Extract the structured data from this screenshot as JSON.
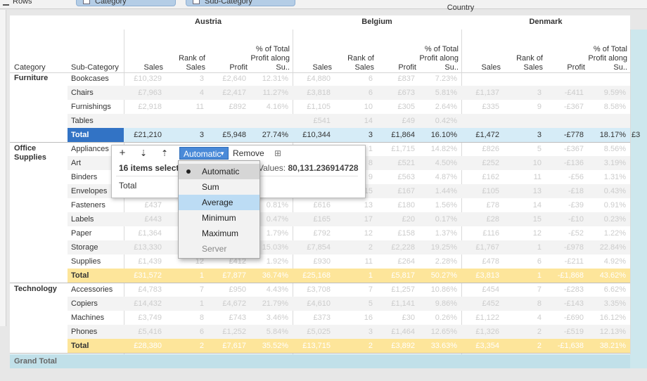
{
  "shelf": {
    "rows_label": "Rows",
    "pills": [
      "Category",
      "Sub-Category"
    ]
  },
  "header": {
    "country_label": "Country",
    "row_header_category": "Category",
    "row_header_subcategory": "Sub-Category",
    "measures": [
      "Sales",
      "Rank of Sales",
      "Profit",
      "% of Total Profit along Su.."
    ],
    "countries": [
      "Austria",
      "Belgium",
      "Denmark"
    ]
  },
  "categories": [
    {
      "name": "Furniture",
      "rows": [
        {
          "sub": "Bookcases",
          "cells": [
            [
              "£10,329",
              "3",
              "£2,640",
              "12.31%"
            ],
            [
              "£4,880",
              "6",
              "£837",
              "7.23%"
            ],
            [
              "",
              "",
              "",
              ""
            ]
          ]
        },
        {
          "sub": "Chairs",
          "cells": [
            [
              "£7,963",
              "4",
              "£2,417",
              "11.27%"
            ],
            [
              "£3,818",
              "6",
              "£673",
              "5.81%"
            ],
            [
              "£1,137",
              "3",
              "-£411",
              "9.59%"
            ]
          ]
        },
        {
          "sub": "Furnishings",
          "cells": [
            [
              "£2,918",
              "11",
              "£892",
              "4.16%"
            ],
            [
              "£1,105",
              "10",
              "£305",
              "2.64%"
            ],
            [
              "£335",
              "9",
              "-£367",
              "8.58%"
            ]
          ]
        },
        {
          "sub": "Tables",
          "cells": [
            [
              "",
              "",
              "",
              ""
            ],
            [
              "£541",
              "14",
              "£49",
              "0.42%"
            ],
            [
              "",
              "",
              "",
              ""
            ]
          ]
        }
      ],
      "total_label": "Total",
      "total": [
        [
          "£21,210",
          "3",
          "£5,948",
          "27.74%"
        ],
        [
          "£10,344",
          "3",
          "£1,864",
          "16.10%"
        ],
        [
          "£1,472",
          "3",
          "-£778",
          "18.17%"
        ]
      ],
      "total_extra": "£3",
      "total_style": "selected"
    },
    {
      "name": "Office Supplies",
      "rows": [
        {
          "sub": "Appliances",
          "cells": [
            [
              "",
              "",
              "",
              ""
            ],
            [
              "",
              "1",
              "£1,715",
              "14.82%"
            ],
            [
              "£826",
              "5",
              "-£367",
              "8.56%"
            ]
          ]
        },
        {
          "sub": "Art",
          "cells": [
            [
              "",
              "",
              "",
              ""
            ],
            [
              "",
              "8",
              "£521",
              "4.50%"
            ],
            [
              "£252",
              "10",
              "-£136",
              "3.19%"
            ]
          ]
        },
        {
          "sub": "Binders",
          "cells": [
            [
              "",
              "",
              "",
              ""
            ],
            [
              "",
              "9",
              "£563",
              "4.87%"
            ],
            [
              "£162",
              "11",
              "-£56",
              "1.31%"
            ]
          ]
        },
        {
          "sub": "Envelopes",
          "cells": [
            [
              "",
              "",
              "",
              ""
            ],
            [
              "",
              "15",
              "£167",
              "1.44%"
            ],
            [
              "£105",
              "13",
              "-£18",
              "0.43%"
            ]
          ]
        },
        {
          "sub": "Fasteners",
          "cells": [
            [
              "£437",
              "",
              "",
              "0.81%"
            ],
            [
              "£616",
              "13",
              "£180",
              "1.56%"
            ],
            [
              "£78",
              "14",
              "-£39",
              "0.91%"
            ]
          ]
        },
        {
          "sub": "Labels",
          "cells": [
            [
              "£443",
              "",
              "",
              "0.47%"
            ],
            [
              "£165",
              "17",
              "£20",
              "0.17%"
            ],
            [
              "£28",
              "15",
              "-£10",
              "0.23%"
            ]
          ]
        },
        {
          "sub": "Paper",
          "cells": [
            [
              "£1,364",
              "",
              "",
              "1.79%"
            ],
            [
              "£792",
              "12",
              "£158",
              "1.37%"
            ],
            [
              "£116",
              "12",
              "-£52",
              "1.22%"
            ]
          ]
        },
        {
          "sub": "Storage",
          "cells": [
            [
              "£13,330",
              "",
              "",
              "15.03%"
            ],
            [
              "£7,854",
              "2",
              "£2,228",
              "19.25%"
            ],
            [
              "£1,767",
              "1",
              "-£978",
              "22.84%"
            ]
          ]
        },
        {
          "sub": "Supplies",
          "cells": [
            [
              "£1,439",
              "12",
              "£412",
              "1.92%"
            ],
            [
              "£930",
              "11",
              "£264",
              "2.28%"
            ],
            [
              "£478",
              "6",
              "-£211",
              "4.92%"
            ]
          ]
        }
      ],
      "total_label": "Total",
      "total": [
        [
          "£31,572",
          "1",
          "£7,877",
          "36.74%"
        ],
        [
          "£25,168",
          "1",
          "£5,817",
          "50.27%"
        ],
        [
          "£3,813",
          "1",
          "-£1,868",
          "43.62%"
        ]
      ],
      "total_style": "yellow"
    },
    {
      "name": "Technology",
      "rows": [
        {
          "sub": "Accessories",
          "cells": [
            [
              "£4,783",
              "7",
              "£950",
              "4.43%"
            ],
            [
              "£3,708",
              "7",
              "£1,257",
              "10.86%"
            ],
            [
              "£454",
              "7",
              "-£283",
              "6.62%"
            ]
          ]
        },
        {
          "sub": "Copiers",
          "cells": [
            [
              "£14,432",
              "1",
              "£4,672",
              "21.79%"
            ],
            [
              "£4,610",
              "5",
              "£1,141",
              "9.86%"
            ],
            [
              "£452",
              "8",
              "-£143",
              "3.35%"
            ]
          ]
        },
        {
          "sub": "Machines",
          "cells": [
            [
              "£3,749",
              "8",
              "£743",
              "3.46%"
            ],
            [
              "£373",
              "16",
              "£30",
              "0.26%"
            ],
            [
              "£1,122",
              "4",
              "-£690",
              "16.12%"
            ]
          ]
        },
        {
          "sub": "Phones",
          "cells": [
            [
              "£5,416",
              "6",
              "£1,252",
              "5.84%"
            ],
            [
              "£5,025",
              "3",
              "£1,464",
              "12.65%"
            ],
            [
              "£1,326",
              "2",
              "-£519",
              "12.13%"
            ]
          ]
        }
      ],
      "total_label": "Total",
      "total": [
        [
          "£28,380",
          "2",
          "£7,617",
          "35.52%"
        ],
        [
          "£13,715",
          "2",
          "£3,892",
          "33.63%"
        ],
        [
          "£3,354",
          "2",
          "-£1,638",
          "38.21%"
        ]
      ],
      "total_style": "yellow"
    }
  ],
  "grand_total_label": "Grand Total",
  "toolbar": {
    "add": "+",
    "sort_desc": "⇣",
    "sort_asc": "⇡",
    "agg_label": "Automatic",
    "remove_label": "Remove",
    "grid_icon": "⊞",
    "selected_count": "16 items selected",
    "values_label": "Values:",
    "values_value": "80,131.236914728",
    "total_label": "Total"
  },
  "agg_menu": {
    "items": [
      "Automatic",
      "Sum",
      "Average",
      "Minimum",
      "Maximum",
      "Server"
    ],
    "checked": "Automatic",
    "highlighted": "Average",
    "disabled": "Server"
  },
  "colors": {
    "selected_total_bg": "#d6ecf7",
    "selected_label_bg": "#3273c5",
    "yellow_total_bg": "#fde59a",
    "grand_total_bg": "#c1e0e9",
    "menu_highlight": "#bcdcf4"
  }
}
